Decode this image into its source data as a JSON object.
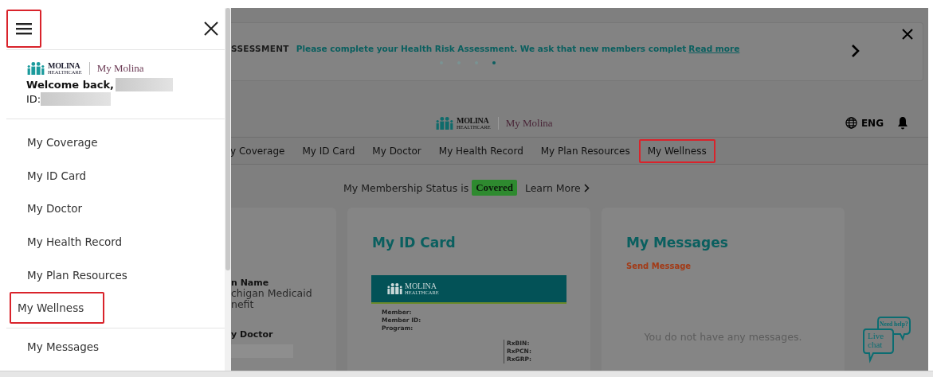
{
  "drawer": {
    "menu_highlighted": true,
    "logo": {
      "wordmark": "MOLINA",
      "subword": "HEALTHCARE",
      "product": "My Molina"
    },
    "welcome": "Welcome back,",
    "id_label": "ID:",
    "items": [
      {
        "label": "My Coverage",
        "highlighted": false
      },
      {
        "label": "My ID Card",
        "highlighted": false
      },
      {
        "label": "My Doctor",
        "highlighted": false
      },
      {
        "label": "My Health Record",
        "highlighted": false
      },
      {
        "label": "My Plan Resources",
        "highlighted": false
      },
      {
        "label": "My Wellness",
        "highlighted": true
      }
    ],
    "more_items": [
      {
        "label": "My Messages",
        "highlighted": false
      }
    ]
  },
  "banner": {
    "title": "SSESSMENT",
    "message": "Please complete your Health Risk Assessment. We ask that new members complet",
    "link": "Read more",
    "dots": [
      {
        "selected": false
      },
      {
        "selected": false
      },
      {
        "selected": false
      },
      {
        "selected": true
      }
    ]
  },
  "header": {
    "logo": {
      "wordmark": "MOLINA",
      "subword": "HEALTHCARE",
      "product": "My Molina"
    },
    "language": "ENG"
  },
  "nav": [
    {
      "label": "y Coverage",
      "highlighted": false
    },
    {
      "label": "My ID Card",
      "highlighted": false
    },
    {
      "label": "My Doctor",
      "highlighted": false
    },
    {
      "label": "My Health Record",
      "highlighted": false
    },
    {
      "label": "My Plan Resources",
      "highlighted": false
    },
    {
      "label": "My Wellness",
      "highlighted": true
    }
  ],
  "membership": {
    "prefix": "My Membership Status is",
    "status": "Covered",
    "link": "Learn More"
  },
  "cards": [
    {
      "kind": "plan",
      "fields": [
        {
          "kind": "text",
          "label": "n Name",
          "lines": [
            "chigan Medicaid",
            "nefit"
          ]
        },
        {
          "kind": "redacted",
          "label": "y Doctor"
        }
      ]
    },
    {
      "kind": "id_card",
      "title": "My ID Card",
      "wordmark": "MOLINA",
      "subword": "HEALTHCARE",
      "card_fields": [
        "Member:",
        "Member ID:",
        "Program:"
      ],
      "rx_fields": [
        "RxBIN:",
        "RxPCN:",
        "RxGRP:"
      ]
    },
    {
      "kind": "messages",
      "title": "My Messages",
      "action": "Send Message",
      "empty": "You do not have any messages."
    }
  ],
  "live_chat": {
    "bubble": "Need help?",
    "label": "Live chat"
  }
}
